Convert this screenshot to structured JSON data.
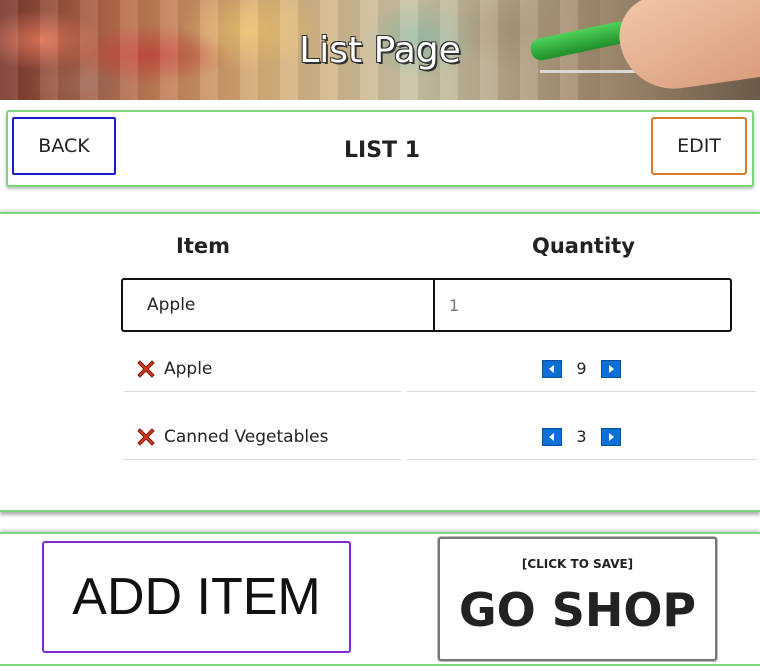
{
  "hero": {
    "title": "List Page"
  },
  "header": {
    "back_label": "BACK",
    "list_title": "LIST 1",
    "edit_label": "EDIT"
  },
  "table": {
    "columns": {
      "item": "Item",
      "quantity": "Quantity"
    },
    "new_entry": {
      "item_value": "Apple",
      "quantity_placeholder": "1"
    },
    "rows": [
      {
        "name": "Apple",
        "quantity": "9"
      },
      {
        "name": "Canned Vegetables",
        "quantity": "3"
      }
    ]
  },
  "actions": {
    "add_item_label": "ADD ITEM",
    "go_shop_hint": "[CLICK TO SAVE]",
    "go_shop_label": "GO SHOP"
  },
  "colors": {
    "card_border": "#7cd67c",
    "back_border": "#1a1acc",
    "edit_border": "#d67a2a",
    "add_border": "#7a2ad6",
    "arrow_button": "#0b6fd6",
    "delete_icon": "#d93a1a"
  },
  "icons": {
    "delete": "close-icon",
    "decrement": "arrow-left-icon",
    "increment": "arrow-right-icon"
  }
}
